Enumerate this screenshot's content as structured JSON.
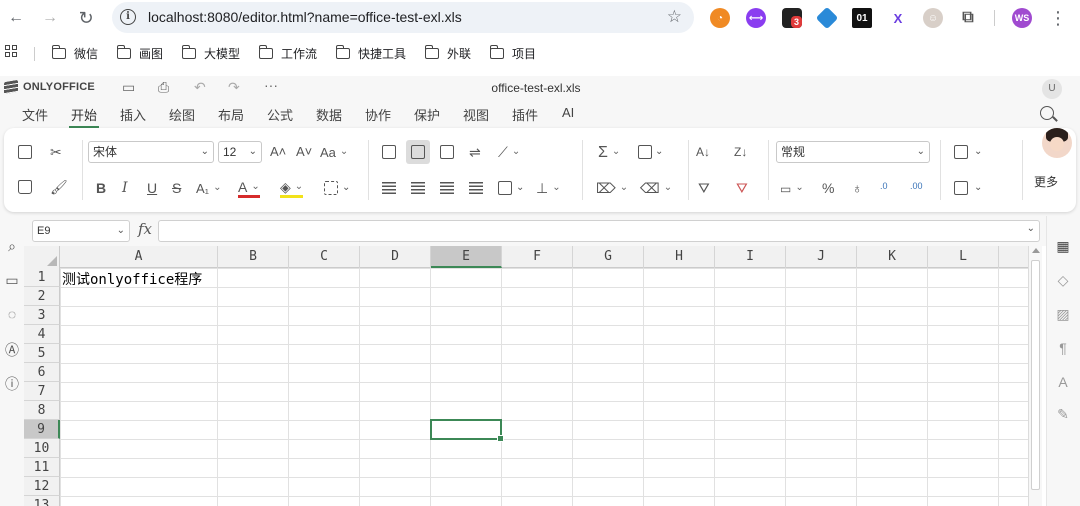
{
  "browser": {
    "url": "localhost:8080/editor.html?name=office-test-exl.xls",
    "badge_count": "3",
    "profile_initials": "WS",
    "ext_01": "01",
    "ext_x": "X"
  },
  "bookmarks": [
    "微信",
    "画图",
    "大模型",
    "工作流",
    "快捷工具",
    "外联",
    "项目"
  ],
  "editor": {
    "logo": "ONLYOFFICE",
    "doc_title": "office-test-exl.xls",
    "user_initial": "U",
    "more_actions": "···"
  },
  "menu_tabs": [
    "文件",
    "开始",
    "插入",
    "绘图",
    "布局",
    "公式",
    "数据",
    "协作",
    "保护",
    "视图",
    "插件",
    "AI"
  ],
  "active_tab_index": 1,
  "toolbar": {
    "font_name": "宋体",
    "font_size": "12",
    "number_format": "常规",
    "more_label": "更多",
    "grow_font": "A˄",
    "shrink_font": "A˅",
    "change_case": "Aa",
    "bold": "B",
    "italic": "I",
    "underline": "U",
    "strike": "S",
    "subscript": "A₁",
    "font_color": "A",
    "sum": "Σ",
    "percent": "%",
    "decimal_inc": ".00",
    "decimal_dec": ".0"
  },
  "formula_bar": {
    "cell_ref": "E9",
    "fx_label": "fx",
    "formula": ""
  },
  "sheet": {
    "columns": [
      "A",
      "B",
      "C",
      "D",
      "E",
      "F",
      "G",
      "H",
      "I",
      "J",
      "K",
      "L"
    ],
    "rows": [
      "1",
      "2",
      "3",
      "4",
      "5",
      "6",
      "7",
      "8",
      "9",
      "10",
      "11",
      "12",
      "13"
    ],
    "selected_column": "E",
    "selected_row": "9",
    "a1_value": "测试onlyoffice程序"
  }
}
